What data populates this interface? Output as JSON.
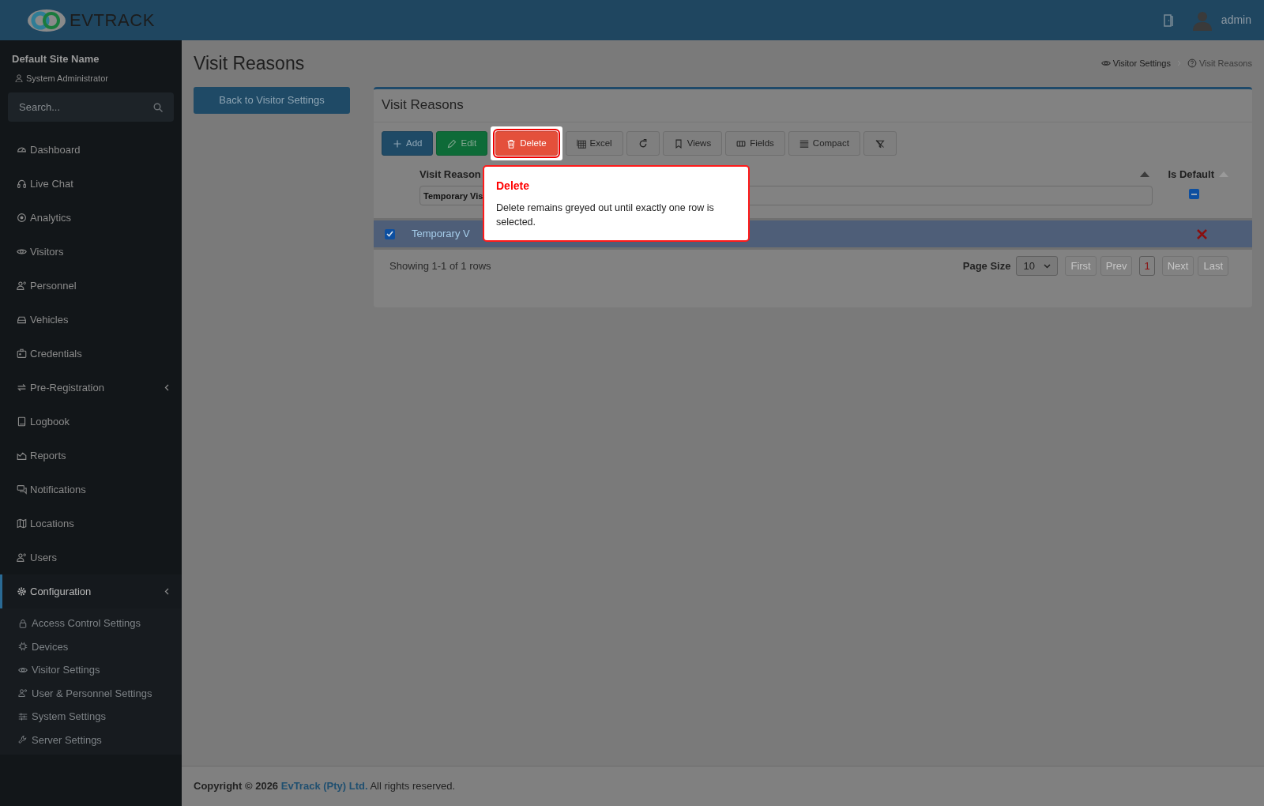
{
  "header": {
    "logo": "**EV**TRACK",
    "user": "admin"
  },
  "sidebar": {
    "site_name": "Default Site Name",
    "role": "System Administrator",
    "search": {
      "placeholder": "Search..."
    },
    "items": [
      {
        "label": "Dashboard",
        "expandable": false,
        "selected": false
      },
      {
        "label": "Live Chat",
        "expandable": false,
        "selected": false
      },
      {
        "label": "Analytics",
        "expandable": false,
        "selected": false
      },
      {
        "label": "Visitors",
        "expandable": false,
        "selected": false
      },
      {
        "label": "Personnel",
        "expandable": false,
        "selected": false
      },
      {
        "label": "Vehicles",
        "expandable": false,
        "selected": false
      },
      {
        "label": "Credentials",
        "expandable": false,
        "selected": false
      },
      {
        "label": "Pre-Registration",
        "expandable": true,
        "selected": false
      },
      {
        "label": "Logbook",
        "expandable": false,
        "selected": false
      },
      {
        "label": "Reports",
        "expandable": false,
        "selected": false
      },
      {
        "label": "Notifications",
        "expandable": false,
        "selected": false
      },
      {
        "label": "Locations",
        "expandable": false,
        "selected": false
      },
      {
        "label": "Users",
        "expandable": false,
        "selected": false
      },
      {
        "label": "Configuration",
        "expandable": true,
        "selected": true,
        "children": [
          {
            "label": "Access Control Settings"
          },
          {
            "label": "Devices"
          },
          {
            "label": "Visitor Settings"
          },
          {
            "label": "User & Personnel Settings"
          },
          {
            "label": "System Settings"
          },
          {
            "label": "Server Settings"
          }
        ]
      }
    ]
  },
  "page": {
    "title": "Visit Reasons",
    "back_button": "Back to Visitor Settings",
    "breadcrumb": [
      {
        "label": "Visitor Settings"
      },
      {
        "label": "Visit Reasons"
      }
    ]
  },
  "card": {
    "title": "Visit Reasons",
    "toolbar": [
      {
        "label": "Add",
        "kind": "primary",
        "highlighted": false
      },
      {
        "label": "Edit",
        "kind": "success",
        "highlighted": false
      },
      {
        "label": "Delete",
        "kind": "danger",
        "highlighted": true
      },
      {
        "label": "Excel",
        "kind": "default",
        "highlighted": false
      },
      {
        "kind": "default",
        "highlighted": false
      },
      {
        "label": "Views",
        "kind": "default",
        "highlighted": false
      },
      {
        "label": "Fields",
        "kind": "default",
        "highlighted": false
      },
      {
        "label": "Compact",
        "kind": "default",
        "highlighted": false
      },
      {
        "kind": "default",
        "highlighted": false
      }
    ],
    "table": {
      "columns": [
        {
          "label": "Visit Reason",
          "filter_value": "Temporary Vis"
        },
        {
          "label": "Is Default",
          "filter_indeterminate": true
        }
      ],
      "rows": [
        {
          "selected": true,
          "visit_reason": "Temporary V",
          "is_default": false
        }
      ]
    },
    "status": "Showing 1-1 of 1 rows",
    "pagination": {
      "page_size_label": "Page Size",
      "page_size": "10",
      "buttons": [
        {
          "label": "First",
          "disabled": true,
          "selected": false
        },
        {
          "label": "Prev",
          "disabled": true,
          "selected": false
        },
        {
          "label": "1",
          "disabled": false,
          "selected": true
        },
        {
          "label": "Next",
          "disabled": true,
          "selected": false
        },
        {
          "label": "Last",
          "disabled": true,
          "selected": false
        }
      ]
    }
  },
  "tooltip": {
    "title": "Delete",
    "text": "Delete remains greyed out until exactly one row is selected."
  },
  "footer": {
    "prefix": "Copyright © 2026",
    "link": "EvTrack (Pty) Ltd.",
    "suffix": "All rights reserved."
  }
}
